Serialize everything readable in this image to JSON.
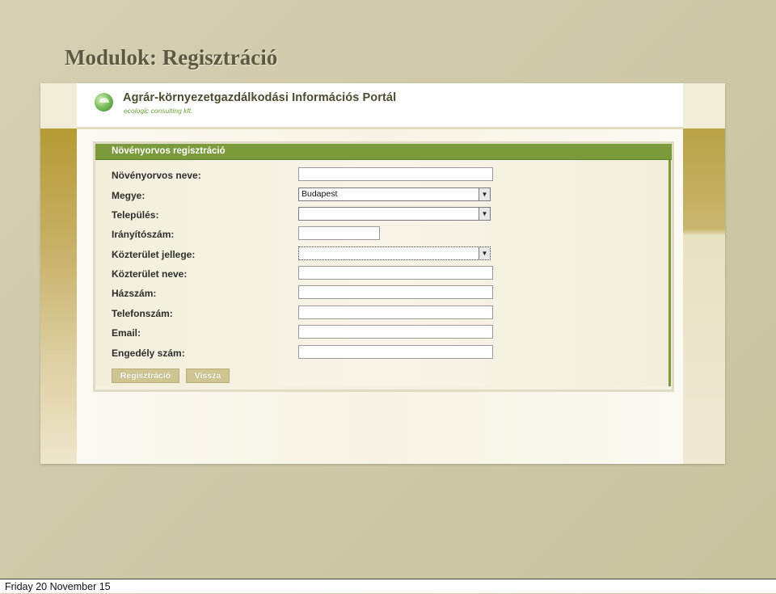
{
  "slide": {
    "title": "Modulok: Regisztráció",
    "footer_date": "Friday 20 November 15"
  },
  "portal": {
    "name": "Agrár-környezetgazdálkodási Információs Portál",
    "subtitle": "ecologic consulting kft.",
    "logo_icon": "ecologic-logo-icon"
  },
  "form": {
    "title": "Növényorvos regisztráció",
    "fields": {
      "name": {
        "label": "Növényorvos neve:",
        "value": ""
      },
      "county": {
        "label": "Megye:",
        "value": "Budapest"
      },
      "city": {
        "label": "Település:",
        "value": ""
      },
      "zip": {
        "label": "Irányítószám:",
        "value": ""
      },
      "street_type": {
        "label": "Közterület jellege:",
        "value": ""
      },
      "street_name": {
        "label": "Közterület neve:",
        "value": ""
      },
      "house_number": {
        "label": "Házszám:",
        "value": ""
      },
      "phone": {
        "label": "Telefonszám:",
        "value": ""
      },
      "email": {
        "label": "Email:",
        "value": ""
      },
      "license": {
        "label": "Engedély szám:",
        "value": ""
      }
    },
    "buttons": {
      "register": "Regisztráció",
      "back": "Vissza"
    }
  },
  "colors": {
    "panel_header": "#7a9a3c",
    "button": "#cfc590",
    "title_text": "#5b5a40"
  }
}
